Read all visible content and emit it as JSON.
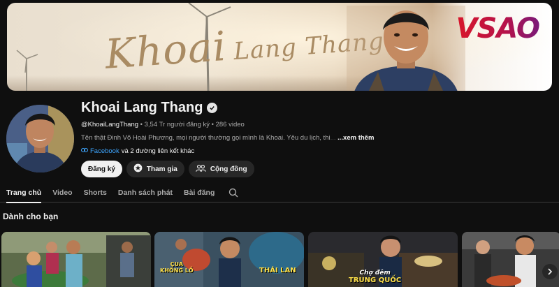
{
  "banner": {
    "script_title_big": "Khoai",
    "script_title_small": "Lang Thang",
    "sponsor_logo": "VSAO",
    "colors": {
      "sponsor_red": "#d8172b"
    }
  },
  "channel": {
    "name": "Khoai Lang Thang",
    "handle": "@KhoaiLangThang",
    "stats": " • 3,54 Tr người đăng ký • 286 video",
    "description": "Tên thật Đinh Võ Hoài Phương, mọi người thường gọi mình là Khoai. Yêu du lịch, thi",
    "description_fade": "...",
    "more_label": "...xem thêm",
    "link_primary": "Facebook",
    "link_more": "và 2 đường liên kết khác",
    "verified_icon": "check-circle-icon"
  },
  "actions": {
    "subscribe": "Đăng ký",
    "join": "Tham gia",
    "community": "Cộng đồng"
  },
  "tabs": [
    {
      "label": "Trang chủ",
      "active": true
    },
    {
      "label": "Video"
    },
    {
      "label": "Shorts"
    },
    {
      "label": "Danh sách phát"
    },
    {
      "label": "Bài đăng"
    }
  ],
  "section": {
    "title": "Dành cho bạn"
  },
  "thumbnails": [
    {
      "overlay": ""
    },
    {
      "overlay_line1": "CUA",
      "overlay_line2": "KHỔNG LỒ",
      "overlay_right": "THÁI LAN"
    },
    {
      "overlay_line1": "Chợ đêm",
      "overlay_line2": "TRUNG QUỐC"
    },
    {
      "overlay": ""
    }
  ]
}
